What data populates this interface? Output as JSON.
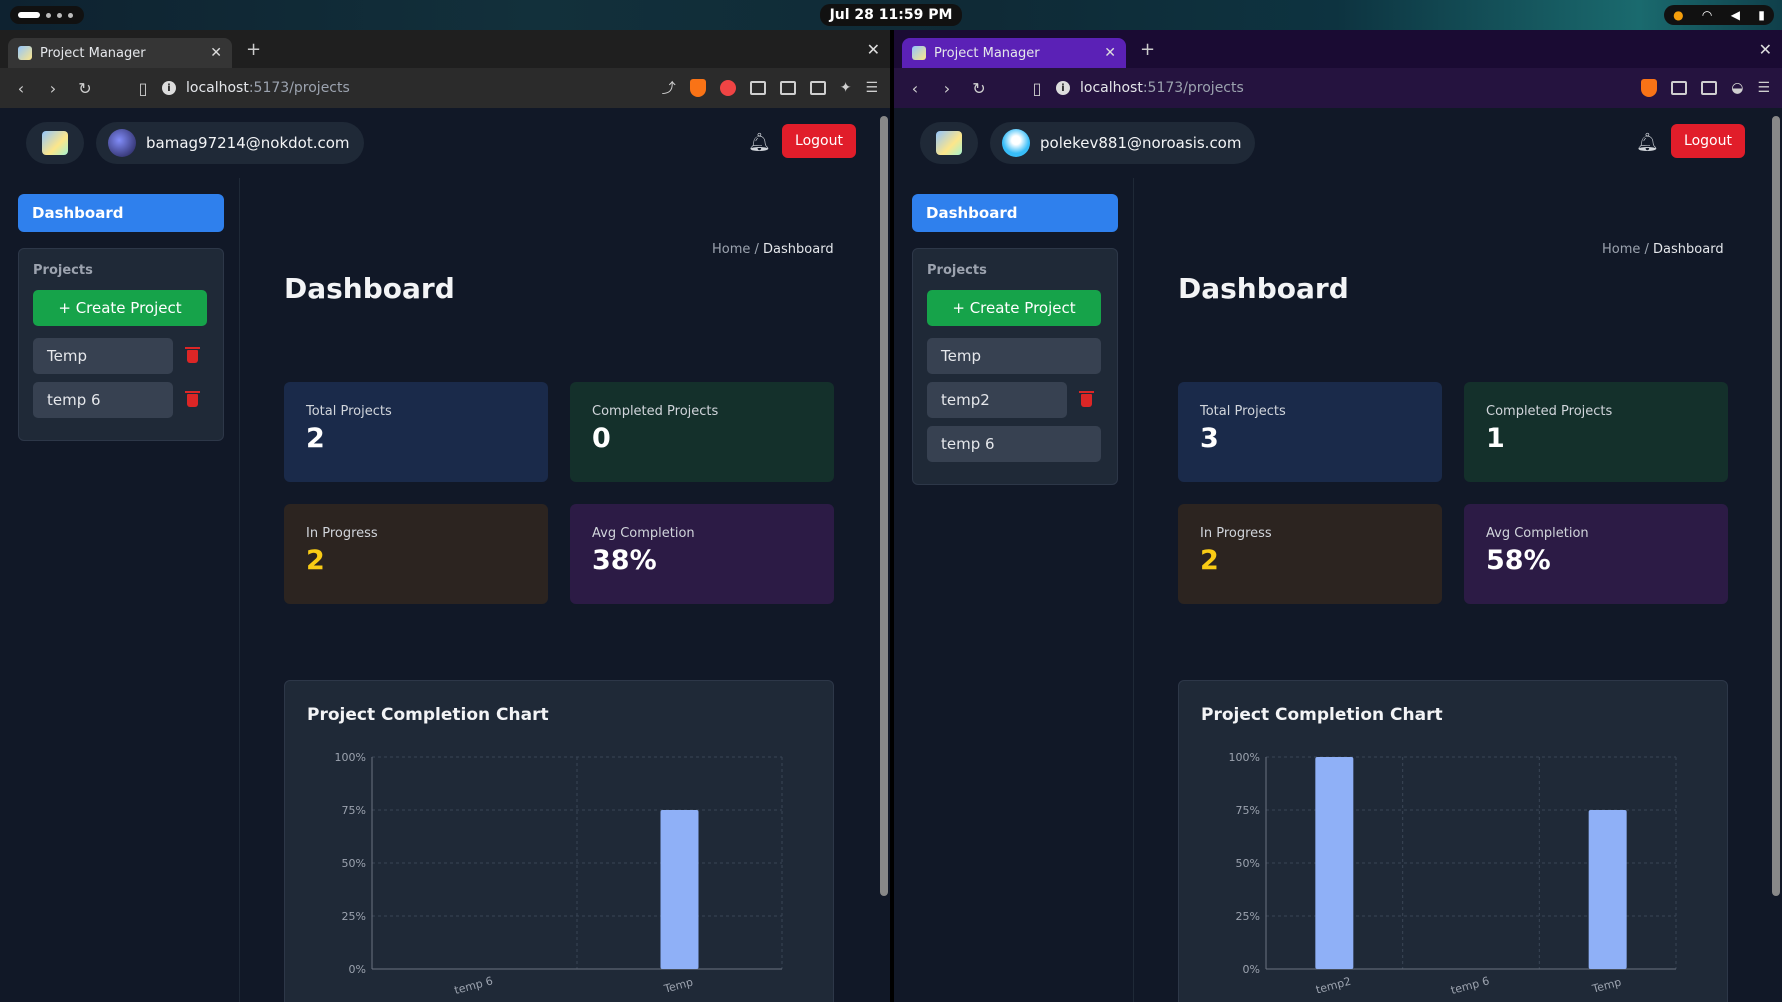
{
  "system": {
    "clock": "Jul 28  11:59 PM"
  },
  "left": {
    "tab_title": "Project Manager",
    "url_host": "localhost",
    "url_path": ":5173/projects",
    "user_email": "bamag97214@nokdot.com",
    "logout_label": "Logout",
    "nav_dashboard": "Dashboard",
    "projects_heading": "Projects",
    "create_label": "+ Create Project",
    "projects": [
      {
        "name": "Temp",
        "deletable": true
      },
      {
        "name": "temp 6",
        "deletable": true
      }
    ],
    "breadcrumb_home": "Home",
    "breadcrumb_sep": " / ",
    "breadcrumb_current": "Dashboard",
    "page_title": "Dashboard",
    "stats": {
      "total_label": "Total Projects",
      "total_value": "2",
      "completed_label": "Completed Projects",
      "completed_value": "0",
      "progress_label": "In Progress",
      "progress_value": "2",
      "avg_label": "Avg Completion",
      "avg_value": "38%"
    },
    "chart_title": "Project Completion Chart"
  },
  "right": {
    "tab_title": "Project Manager",
    "url_host": "localhost",
    "url_path": ":5173/projects",
    "user_email": "polekev881@noroasis.com",
    "logout_label": "Logout",
    "nav_dashboard": "Dashboard",
    "projects_heading": "Projects",
    "create_label": "+ Create Project",
    "projects": [
      {
        "name": "Temp",
        "deletable": false
      },
      {
        "name": "temp2",
        "deletable": true
      },
      {
        "name": "temp 6",
        "deletable": false
      }
    ],
    "breadcrumb_home": "Home",
    "breadcrumb_sep": " / ",
    "breadcrumb_current": "Dashboard",
    "page_title": "Dashboard",
    "stats": {
      "total_label": "Total Projects",
      "total_value": "3",
      "completed_label": "Completed Projects",
      "completed_value": "1",
      "progress_label": "In Progress",
      "progress_value": "2",
      "avg_label": "Avg Completion",
      "avg_value": "58%"
    },
    "chart_title": "Project Completion Chart"
  },
  "colors": {
    "accent_blue": "#2f80ed",
    "create_green": "#16a34a",
    "logout_red": "#e11d2a",
    "bar_color": "#8fb0f7",
    "in_progress_yellow": "#facc15"
  },
  "chart_data": [
    {
      "type": "bar",
      "title": "Project Completion Chart",
      "categories": [
        "temp 6",
        "Temp"
      ],
      "values": [
        0,
        75
      ],
      "y_ticks": [
        "0%",
        "25%",
        "50%",
        "75%",
        "100%"
      ],
      "ylim": [
        0,
        100
      ],
      "grid": true
    },
    {
      "type": "bar",
      "title": "Project Completion Chart",
      "categories": [
        "temp2",
        "temp 6",
        "Temp"
      ],
      "values": [
        100,
        0,
        75
      ],
      "y_ticks": [
        "0%",
        "25%",
        "50%",
        "75%",
        "100%"
      ],
      "ylim": [
        0,
        100
      ],
      "grid": true
    }
  ]
}
